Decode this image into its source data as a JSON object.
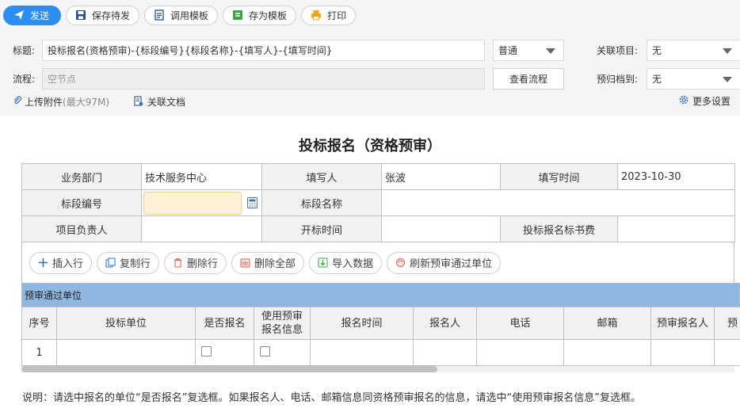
{
  "toolbar": {
    "send": "发送",
    "save_draft": "保存待发",
    "use_template": "调用模板",
    "save_template": "存为模板",
    "print": "打印"
  },
  "form": {
    "title_label": "标题:",
    "title_value": "投标报名(资格预审)-{标段编号}{标段名称}-{填写人}-{填写时间}",
    "priority_value": "普通",
    "related_project_label": "关联项目:",
    "related_project_value": "无",
    "flow_label": "流程:",
    "flow_placeholder": "空节点",
    "view_flow": "查看流程",
    "archive_label": "预归档到:",
    "archive_value": "无",
    "upload": "上传附件",
    "upload_limit": "(最大97M)",
    "related_doc": "关联文档",
    "more_settings": "更多设置"
  },
  "doc": {
    "title": "投标报名（资格预审）",
    "row1": {
      "dept_label": "业务部门",
      "dept_value": "技术服务中心",
      "writer_label": "填写人",
      "writer_value": "张波",
      "time_label": "填写时间",
      "time_value": "2023-10-30"
    },
    "row2": {
      "section_no_label": "标段编号",
      "section_name_label": "标段名称"
    },
    "row3": {
      "manager_label": "项目负责人",
      "open_time_label": "开标时间",
      "fee_label": "投标报名标书费"
    }
  },
  "actions": {
    "insert": "插入行",
    "copy": "复制行",
    "delete": "删除行",
    "delete_all": "删除全部",
    "import": "导入数据",
    "refresh": "刷新预审通过单位"
  },
  "subtable": {
    "title": "预审通过单位",
    "headers": [
      "序号",
      "投标单位",
      "是否报名",
      "使用预审报名信息",
      "报名时间",
      "报名人",
      "电话",
      "邮箱",
      "预审报名人",
      "预"
    ],
    "header_line1": "使用预审",
    "header_line2": "报名信息",
    "rows": [
      {
        "no": "1"
      }
    ]
  },
  "note": "说明：请选中报名的单位“是否报名”复选框。如果报名人、电话、邮箱信息同资格预审报名的信息，请选中“使用预审报名信息”复选框。",
  "colors": {
    "primary": "#2d8ef2",
    "section_bar": "#8fb7e0",
    "highlight_input": "#fff1d6"
  }
}
